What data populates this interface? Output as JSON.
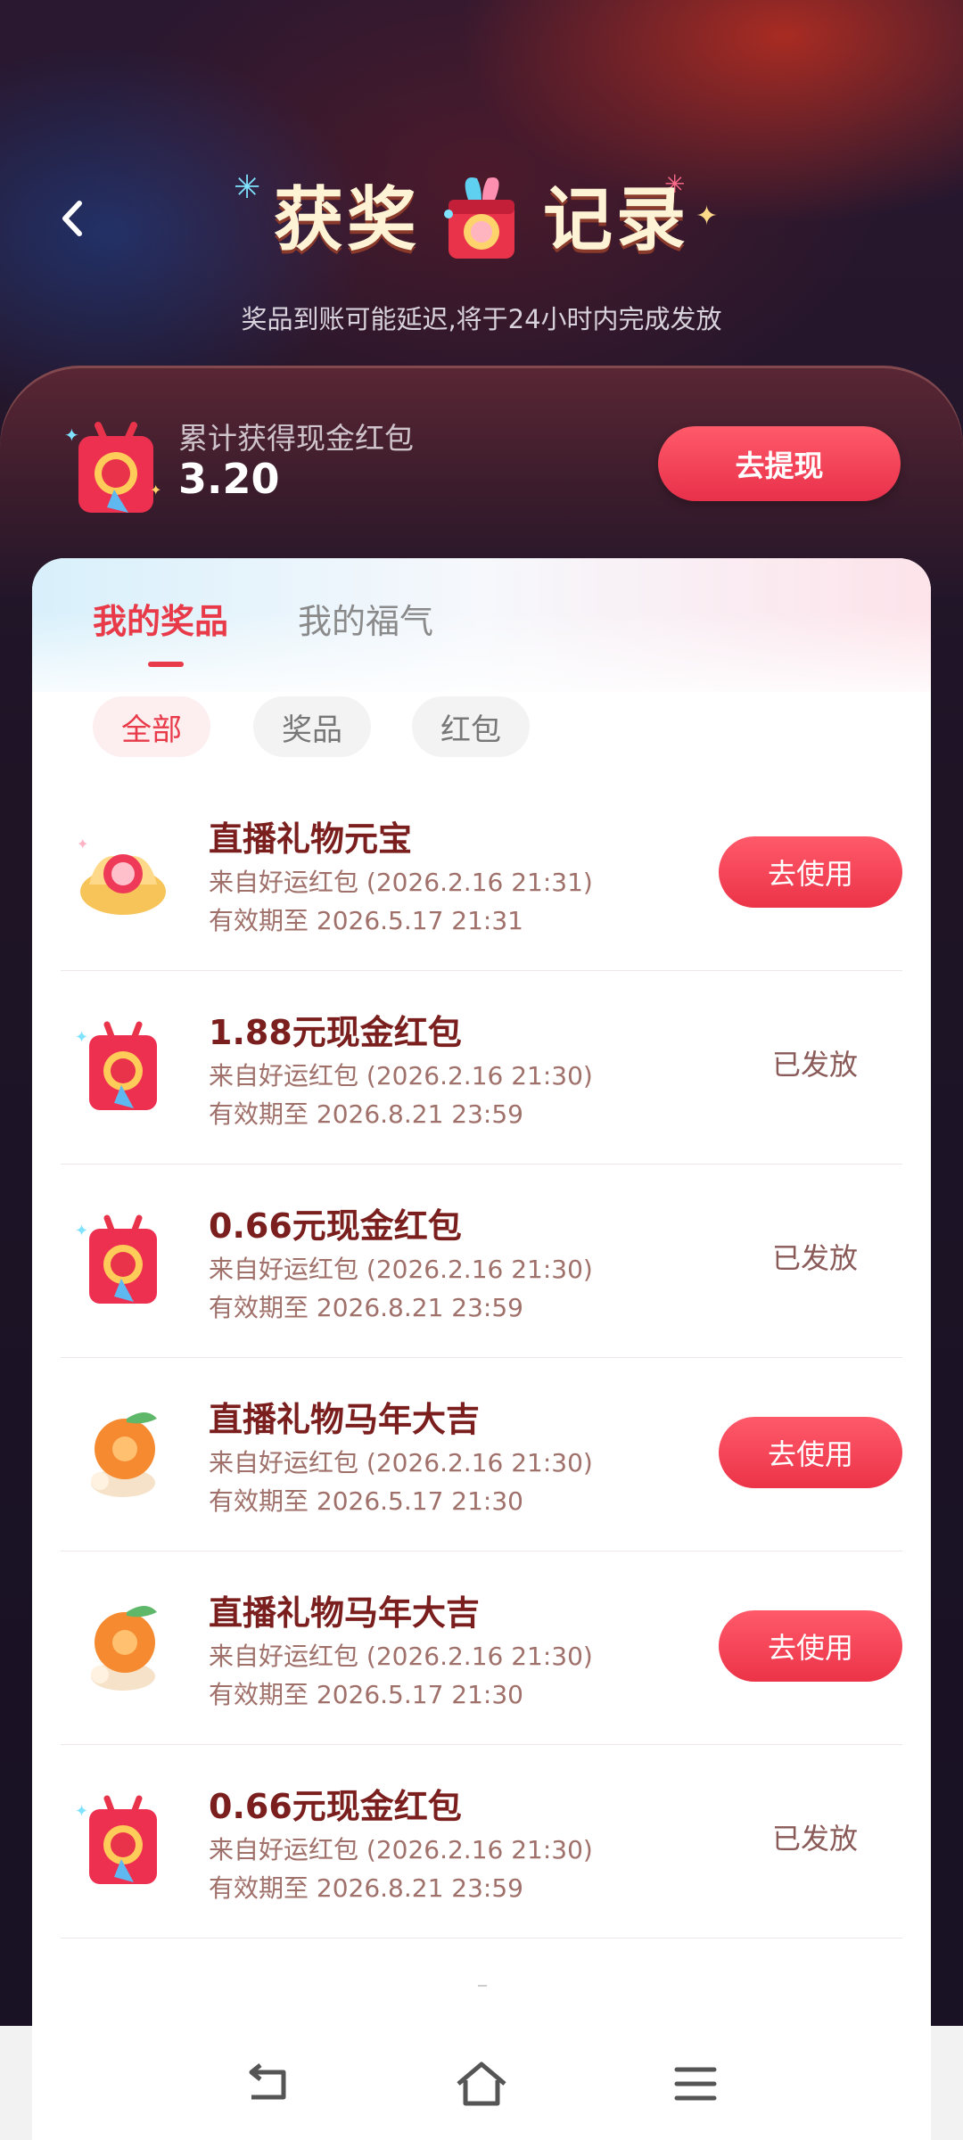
{
  "header": {
    "back_icon": "chevron-left-icon",
    "title_left": "获奖",
    "title_right": "记录",
    "subtitle": "奖品到账可能延迟,将于24小时内完成发放"
  },
  "summary": {
    "label": "累计获得现金红包",
    "value": "3.20",
    "withdraw_label": "去提现"
  },
  "tabs": [
    {
      "label": "我的奖品",
      "active": true
    },
    {
      "label": "我的福气",
      "active": false
    }
  ],
  "filters": [
    {
      "label": "全部",
      "active": true
    },
    {
      "label": "奖品",
      "active": false
    },
    {
      "label": "红包",
      "active": false
    }
  ],
  "items": [
    {
      "icon": "gold-ingot-gift-icon",
      "title": "直播礼物元宝",
      "source": "来自好运红包 (2026.2.16 21:31)",
      "expiry": "有效期至 2026.5.17 21:31",
      "action": "去使用",
      "status": "use"
    },
    {
      "icon": "red-envelope-icon",
      "title": "1.88元现金红包",
      "source": "来自好运红包 (2026.2.16 21:30)",
      "expiry": "有效期至 2026.8.21 23:59",
      "action": "已发放",
      "status": "issued"
    },
    {
      "icon": "red-envelope-icon",
      "title": "0.66元现金红包",
      "source": "来自好运红包 (2026.2.16 21:30)",
      "expiry": "有效期至 2026.8.21 23:59",
      "action": "已发放",
      "status": "issued"
    },
    {
      "icon": "tangerine-gift-icon",
      "title": "直播礼物马年大吉",
      "source": "来自好运红包 (2026.2.16 21:30)",
      "expiry": "有效期至 2026.5.17 21:30",
      "action": "去使用",
      "status": "use"
    },
    {
      "icon": "tangerine-gift-icon",
      "title": "直播礼物马年大吉",
      "source": "来自好运红包 (2026.2.16 21:30)",
      "expiry": "有效期至 2026.5.17 21:30",
      "action": "去使用",
      "status": "use"
    },
    {
      "icon": "red-envelope-icon",
      "title": "0.66元现金红包",
      "source": "来自好运红包 (2026.2.16 21:30)",
      "expiry": "有效期至 2026.8.21 23:59",
      "action": "已发放",
      "status": "issued"
    }
  ],
  "navbar": {
    "back_icon": "nav-back-icon",
    "home_icon": "nav-home-icon",
    "menu_icon": "nav-menu-icon"
  },
  "colors": {
    "accent": "#e83a48",
    "title_text": "#7a1e1e",
    "meta_text": "#a0706a"
  }
}
